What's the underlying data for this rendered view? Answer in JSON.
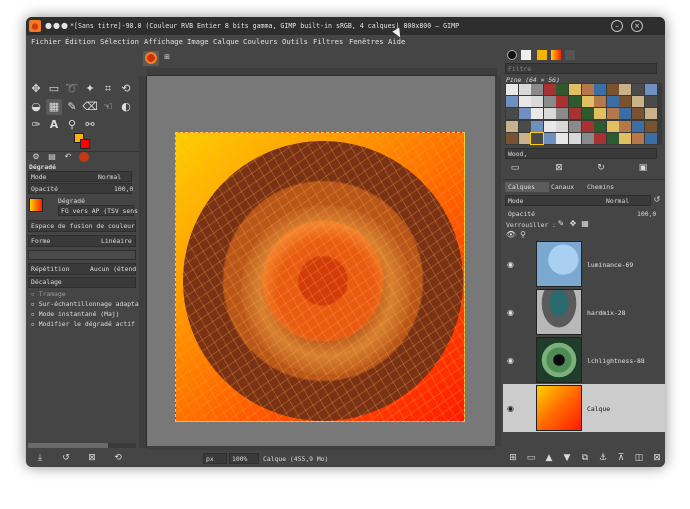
{
  "window": {
    "title": "*[Sans titre]-98.0 (Couleur RVB Entier 8 bits gamma, GIMP built-in sRGB, 4 calques) 800x800 – GIMP",
    "close_label": "×",
    "minimize_label": "–",
    "controls_dots": "●●●"
  },
  "menu": [
    "Fichier",
    "Édition",
    "Sélection",
    "Affichage",
    "Image",
    "Calque",
    "Couleurs",
    "Outils",
    "Filtres",
    "Fenêtres",
    "Aide"
  ],
  "colors": {
    "foreground": "#f6b40e",
    "background": "#ff0000",
    "gradient_start": "#ffd000",
    "gradient_end": "#ff1a00"
  },
  "tool_options": {
    "tab": "Dégradé",
    "mode_label": "Mode",
    "mode_value": "Normal",
    "opacity_label": "Opacité",
    "opacity_value": "100,0",
    "gradient_label": "Dégradé",
    "gradient_value": "FG vers AP (TSV sens",
    "blend_space": "Espace de fusion de couleur R",
    "shape_label": "Forme",
    "shape_value": "Linéaire",
    "repeat_label": "Répétition",
    "repeat_value": "Aucun (étend",
    "offset_label": "Décalage",
    "options": [
      "Tramage",
      "Sur-échantillonnage adaptat",
      "Mode instantané (Maj)",
      "Modifier le dégradé actif"
    ]
  },
  "status": {
    "unit": "px",
    "zoom": "100%",
    "layer_info": "Calque (455,9 Mo)"
  },
  "brushes": {
    "filter_placeholder": "Filtre",
    "selected_title": "Pine (64 × 56)",
    "selected_name": "Wood,"
  },
  "layers_panel": {
    "tabs": [
      "Calques",
      "Canaux",
      "Chemins"
    ],
    "mode_label": "Mode",
    "mode_value": "Normal",
    "opacity_label": "Opacité",
    "opacity_value": "100,0",
    "lock_label": "Verrouiller :",
    "layers": [
      {
        "name": "luminance-69"
      },
      {
        "name": "hardmix-28"
      },
      {
        "name": "lchlightness-88"
      },
      {
        "name": "Calque"
      }
    ]
  }
}
